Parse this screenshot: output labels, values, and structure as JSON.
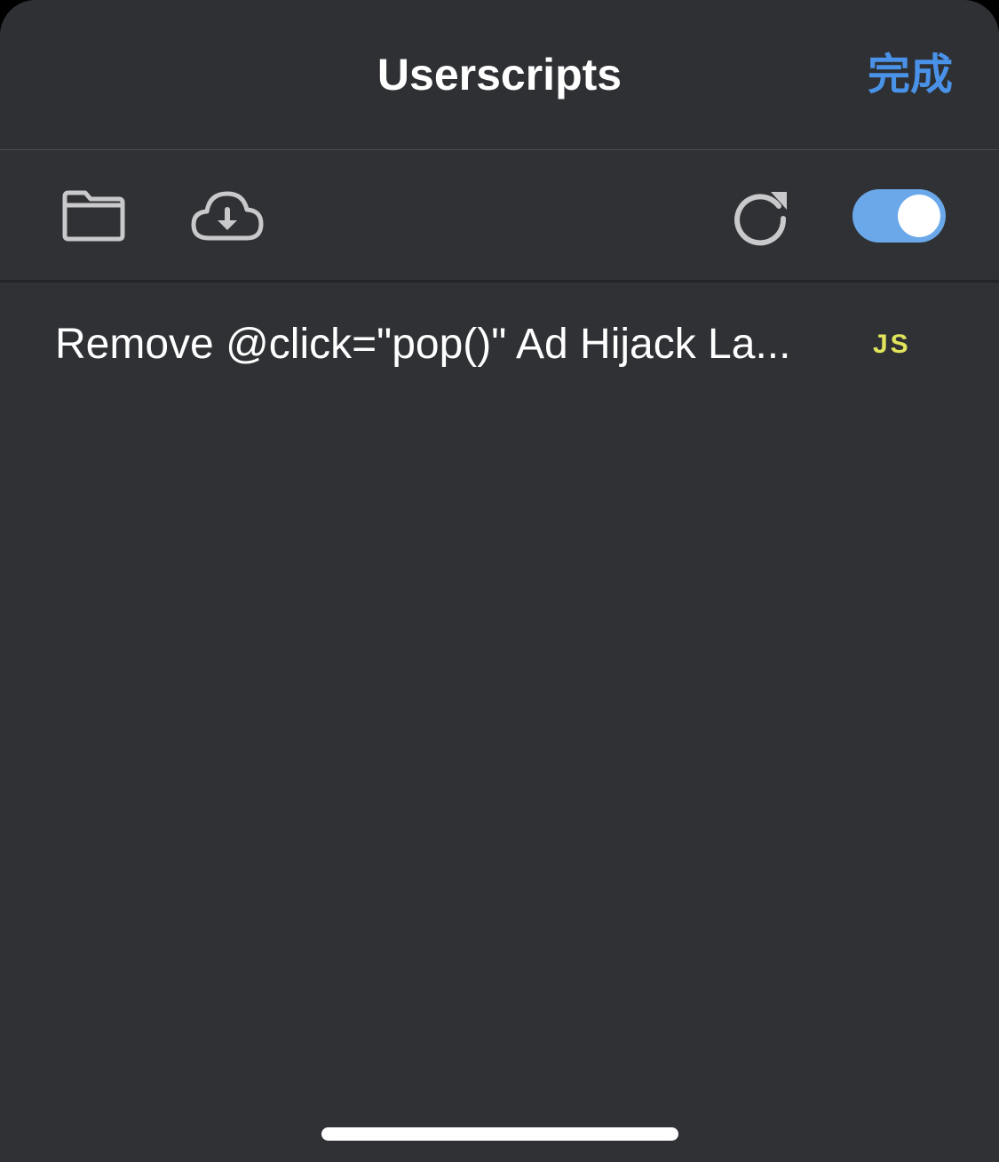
{
  "navbar": {
    "title": "Userscripts",
    "done_label": "完成",
    "accent_color": "#4a92e8"
  },
  "toolbar": {
    "icons": [
      "folder-icon",
      "cloud-download-icon",
      "refresh-icon"
    ],
    "enabled_toggle": {
      "on": true,
      "color": "#6aa8e9"
    }
  },
  "scripts": [
    {
      "name": "Remove @click=\"pop()\" Ad Hijack La...",
      "type_badge": "JS",
      "badge_color": "#e2e45c"
    }
  ]
}
